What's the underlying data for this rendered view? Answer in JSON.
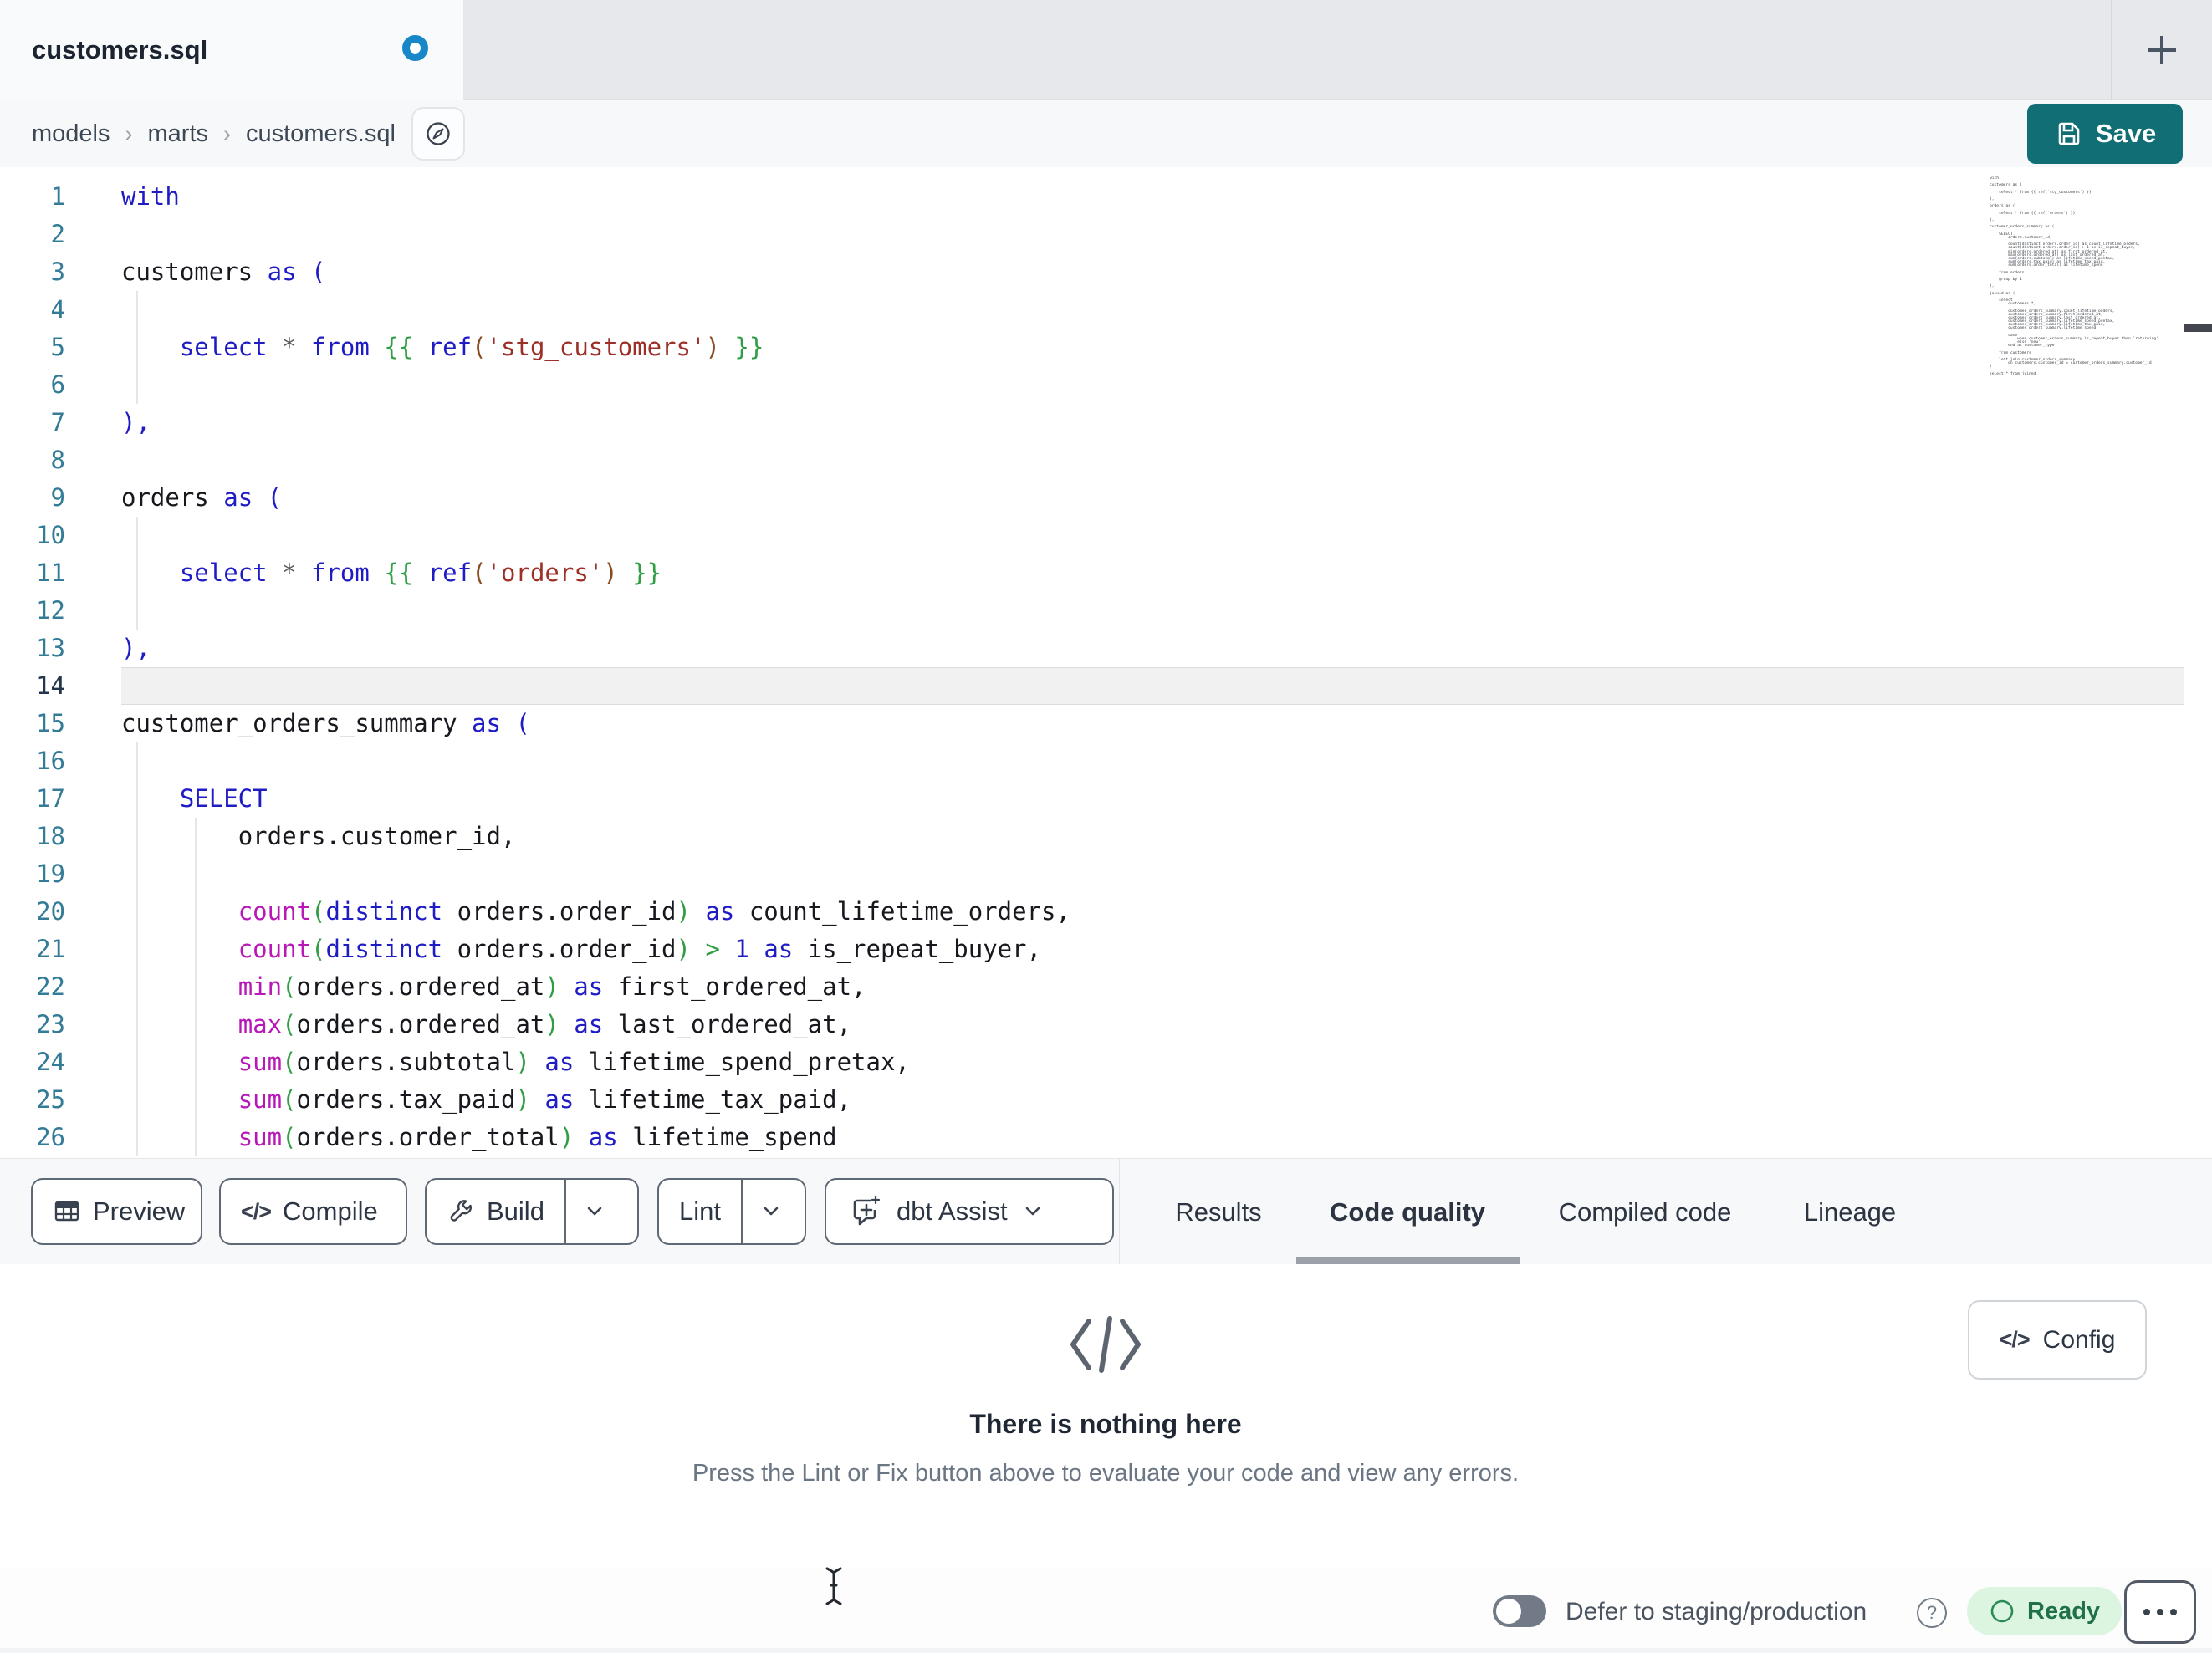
{
  "colors": {
    "accent_teal": "#116e74",
    "unsaved_dot_blue": "#1787c8",
    "ready_bg": "#dcf5e1",
    "ready_text": "#20714a",
    "ready_circle": "#2c8a55",
    "syntax": {
      "kw": "#1f1cc4",
      "fn": "#b818b8",
      "str": "#9c2f27",
      "jj": "#2f9e44",
      "gp": "#2f9e44",
      "bp": "#8a4b21",
      "op": "#5a5a5a",
      "num": "#1f1cc4"
    }
  },
  "tab_bar": {
    "active_tab": "customers.sql",
    "unsaved": true
  },
  "breadcrumb": {
    "items": [
      "models",
      "marts",
      "customers.sql"
    ],
    "separator": "›"
  },
  "header": {
    "save_label": "Save"
  },
  "editor": {
    "active_line": 14,
    "lines": [
      {
        "n": 1,
        "segs": [
          [
            "with",
            "kw"
          ]
        ]
      },
      {
        "n": 2,
        "segs": []
      },
      {
        "n": 3,
        "segs": [
          [
            "customers",
            ""
          ],
          [
            " ",
            ""
          ],
          [
            "as",
            "kw"
          ],
          [
            " ",
            ""
          ],
          [
            "(",
            "kw"
          ]
        ]
      },
      {
        "n": 4,
        "segs": []
      },
      {
        "n": 5,
        "segs": [
          [
            "    ",
            ""
          ],
          [
            "select",
            "kw"
          ],
          [
            " ",
            ""
          ],
          [
            "*",
            "op"
          ],
          [
            " ",
            ""
          ],
          [
            "from",
            "kw"
          ],
          [
            " ",
            ""
          ],
          [
            "{{",
            "jj"
          ],
          [
            " ",
            ""
          ],
          [
            "ref",
            "kw"
          ],
          [
            "(",
            "bp"
          ],
          [
            "'stg_customers'",
            "str"
          ],
          [
            ")",
            "bp"
          ],
          [
            " ",
            ""
          ],
          [
            "}}",
            "jj"
          ]
        ]
      },
      {
        "n": 6,
        "segs": []
      },
      {
        "n": 7,
        "segs": [
          [
            "),",
            "kw"
          ]
        ]
      },
      {
        "n": 8,
        "segs": []
      },
      {
        "n": 9,
        "segs": [
          [
            "orders",
            ""
          ],
          [
            " ",
            ""
          ],
          [
            "as",
            "kw"
          ],
          [
            " ",
            ""
          ],
          [
            "(",
            "kw"
          ]
        ]
      },
      {
        "n": 10,
        "segs": []
      },
      {
        "n": 11,
        "segs": [
          [
            "    ",
            ""
          ],
          [
            "select",
            "kw"
          ],
          [
            " ",
            ""
          ],
          [
            "*",
            "op"
          ],
          [
            " ",
            ""
          ],
          [
            "from",
            "kw"
          ],
          [
            " ",
            ""
          ],
          [
            "{{",
            "jj"
          ],
          [
            " ",
            ""
          ],
          [
            "ref",
            "kw"
          ],
          [
            "(",
            "bp"
          ],
          [
            "'orders'",
            "str"
          ],
          [
            ")",
            "bp"
          ],
          [
            " ",
            ""
          ],
          [
            "}}",
            "jj"
          ]
        ]
      },
      {
        "n": 12,
        "segs": []
      },
      {
        "n": 13,
        "segs": [
          [
            "),",
            "kw"
          ]
        ]
      },
      {
        "n": 14,
        "segs": []
      },
      {
        "n": 15,
        "segs": [
          [
            "customer_orders_summary",
            ""
          ],
          [
            " ",
            ""
          ],
          [
            "as",
            "kw"
          ],
          [
            " ",
            ""
          ],
          [
            "(",
            "kw"
          ]
        ]
      },
      {
        "n": 16,
        "segs": []
      },
      {
        "n": 17,
        "segs": [
          [
            "    ",
            ""
          ],
          [
            "SELECT",
            "kw"
          ]
        ]
      },
      {
        "n": 18,
        "segs": [
          [
            "        ",
            ""
          ],
          [
            "orders.customer_id,",
            ""
          ]
        ]
      },
      {
        "n": 19,
        "segs": []
      },
      {
        "n": 20,
        "segs": [
          [
            "        ",
            ""
          ],
          [
            "count",
            "fn"
          ],
          [
            "(",
            "gp"
          ],
          [
            "distinct",
            "kw"
          ],
          [
            " orders.order_id",
            ""
          ],
          [
            ")",
            "gp"
          ],
          [
            " ",
            ""
          ],
          [
            "as",
            "kw"
          ],
          [
            " count_lifetime_orders,",
            ""
          ]
        ]
      },
      {
        "n": 21,
        "segs": [
          [
            "        ",
            ""
          ],
          [
            "count",
            "fn"
          ],
          [
            "(",
            "gp"
          ],
          [
            "distinct",
            "kw"
          ],
          [
            " orders.order_id",
            ""
          ],
          [
            ")",
            "gp"
          ],
          [
            " ",
            ""
          ],
          [
            ">",
            "gp"
          ],
          [
            " ",
            ""
          ],
          [
            "1",
            "num"
          ],
          [
            " ",
            ""
          ],
          [
            "as",
            "kw"
          ],
          [
            " is_repeat_buyer,",
            ""
          ]
        ]
      },
      {
        "n": 22,
        "segs": [
          [
            "        ",
            ""
          ],
          [
            "min",
            "fn"
          ],
          [
            "(",
            "gp"
          ],
          [
            "orders.ordered_at",
            ""
          ],
          [
            ")",
            "gp"
          ],
          [
            " ",
            ""
          ],
          [
            "as",
            "kw"
          ],
          [
            " first_ordered_at,",
            ""
          ]
        ]
      },
      {
        "n": 23,
        "segs": [
          [
            "        ",
            ""
          ],
          [
            "max",
            "fn"
          ],
          [
            "(",
            "gp"
          ],
          [
            "orders.ordered_at",
            ""
          ],
          [
            ")",
            "gp"
          ],
          [
            " ",
            ""
          ],
          [
            "as",
            "kw"
          ],
          [
            " last_ordered_at,",
            ""
          ]
        ]
      },
      {
        "n": 24,
        "segs": [
          [
            "        ",
            ""
          ],
          [
            "sum",
            "fn"
          ],
          [
            "(",
            "gp"
          ],
          [
            "orders.subtotal",
            ""
          ],
          [
            ")",
            "gp"
          ],
          [
            " ",
            ""
          ],
          [
            "as",
            "kw"
          ],
          [
            " lifetime_spend_pretax,",
            ""
          ]
        ]
      },
      {
        "n": 25,
        "segs": [
          [
            "        ",
            ""
          ],
          [
            "sum",
            "fn"
          ],
          [
            "(",
            "gp"
          ],
          [
            "orders.tax_paid",
            ""
          ],
          [
            ")",
            "gp"
          ],
          [
            " ",
            ""
          ],
          [
            "as",
            "kw"
          ],
          [
            " lifetime_tax_paid,",
            ""
          ]
        ]
      },
      {
        "n": 26,
        "segs": [
          [
            "        ",
            ""
          ],
          [
            "sum",
            "fn"
          ],
          [
            "(",
            "gp"
          ],
          [
            "orders.order_total",
            ""
          ],
          [
            ")",
            "gp"
          ],
          [
            " ",
            ""
          ],
          [
            "as",
            "kw"
          ],
          [
            " lifetime_spend",
            ""
          ]
        ]
      }
    ]
  },
  "minimap": {
    "lines": [
      "with",
      "",
      "customers as (",
      "",
      "    select * from {{ ref('stg_customers') }}",
      "",
      "),",
      "",
      "orders as (",
      "",
      "    select * from {{ ref('orders') }}",
      "",
      "),",
      "",
      "customer_orders_summary as (",
      "",
      "    SELECT",
      "        orders.customer_id,",
      "",
      "        count(distinct orders.order_id) as count_lifetime_orders,",
      "        count(distinct orders.order_id) > 1 as is_repeat_buyer,",
      "        min(orders.ordered_at) as first_ordered_at,",
      "        max(orders.ordered_at) as last_ordered_at,",
      "        sum(orders.subtotal) as lifetime_spend_pretax,",
      "        sum(orders.tax_paid) as lifetime_tax_paid,",
      "        sum(orders.order_total) as lifetime_spend",
      "",
      "    from orders",
      "",
      "    group by 1",
      "",
      "),",
      "",
      "joined as (",
      "",
      "    select",
      "        customers.*,",
      "",
      "        customer_orders_summary.count_lifetime_orders,",
      "        customer_orders_summary.first_ordered_at,",
      "        customer_orders_summary.last_ordered_at,",
      "        customer_orders_summary.lifetime_spend_pretax,",
      "        customer_orders_summary.lifetime_tax_paid,",
      "        customer_orders_summary.lifetime_spend,",
      "",
      "        case",
      "            when customer_orders_summary.is_repeat_buyer then 'returning'",
      "            else 'new'",
      "        end as customer_type",
      "",
      "    from customers",
      "",
      "    left join customer_orders_summary",
      "        on customers.customer_id = customer_orders_summary.customer_id",
      ")",
      "",
      "select * from joined"
    ]
  },
  "toolbar": {
    "buttons": [
      {
        "label": "Preview"
      },
      {
        "label": "Compile"
      },
      {
        "label": "Build"
      },
      {
        "label": "Lint"
      },
      {
        "label": "dbt Assist"
      }
    ]
  },
  "result_tabs": {
    "tabs": [
      "Results",
      "Code quality",
      "Compiled code",
      "Lineage"
    ],
    "active": "Code quality"
  },
  "empty_state": {
    "title": "There is nothing here",
    "description": "Press the Lint or Fix button above to evaluate your code and view any errors."
  },
  "config_button": {
    "label": "Config"
  },
  "status_bar": {
    "defer_label": "Defer to staging/production",
    "defer_enabled": false,
    "status_label": "Ready"
  }
}
